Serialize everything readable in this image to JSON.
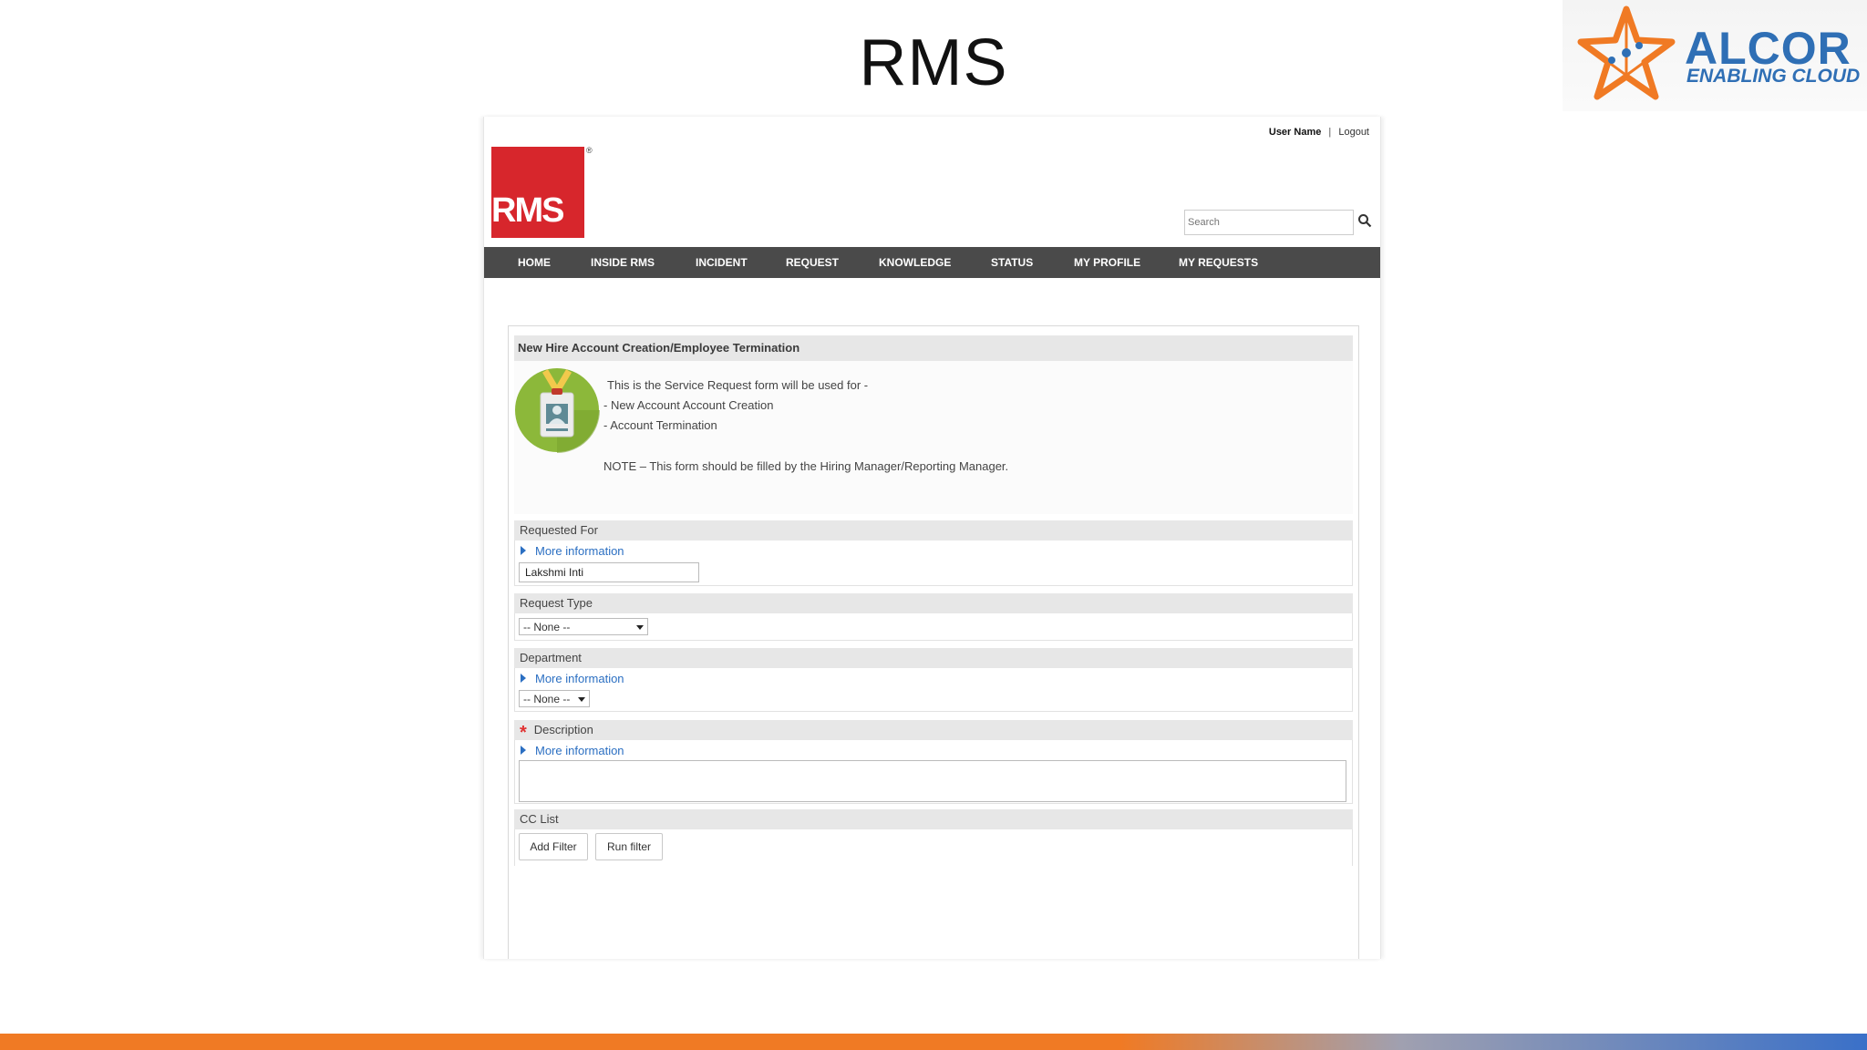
{
  "slide": {
    "title": "RMS"
  },
  "alcor": {
    "name": "ALCOR",
    "tagline": "ENABLING CLOUD"
  },
  "portal": {
    "user_name": "User Name",
    "separator": "|",
    "logout": "Logout",
    "logo_text": "RMS",
    "registered": "®",
    "search_placeholder": "Search",
    "nav": [
      "HOME",
      "INSIDE RMS",
      "INCIDENT",
      "REQUEST",
      "KNOWLEDGE",
      "STATUS",
      "MY PROFILE",
      "MY REQUESTS"
    ]
  },
  "form": {
    "title": "New Hire Account Creation/Employee Termination",
    "intro": [
      "This is the Service Request form will be used for -",
      "- New Account Account Creation",
      "- Account Termination"
    ],
    "note": "NOTE – This form should be filled by the Hiring Manager/Reporting Manager.",
    "more_info": "More information",
    "requested_for": {
      "label": "Requested For",
      "value": "Lakshmi Inti"
    },
    "request_type": {
      "label": "Request Type",
      "selected": "-- None --"
    },
    "department": {
      "label": "Department",
      "selected": "-- None --"
    },
    "description": {
      "label": "Description",
      "required_mark": "*",
      "value": ""
    },
    "cc_list": {
      "label": "CC List",
      "add_filter": "Add Filter",
      "run_filter": "Run filter"
    }
  },
  "colors": {
    "brand_red": "#d7262c",
    "nav_bg": "#4a4a4a",
    "link_blue": "#2b6fc2",
    "alcor_blue": "#2f6fb5",
    "alcor_orange": "#f07a24"
  }
}
